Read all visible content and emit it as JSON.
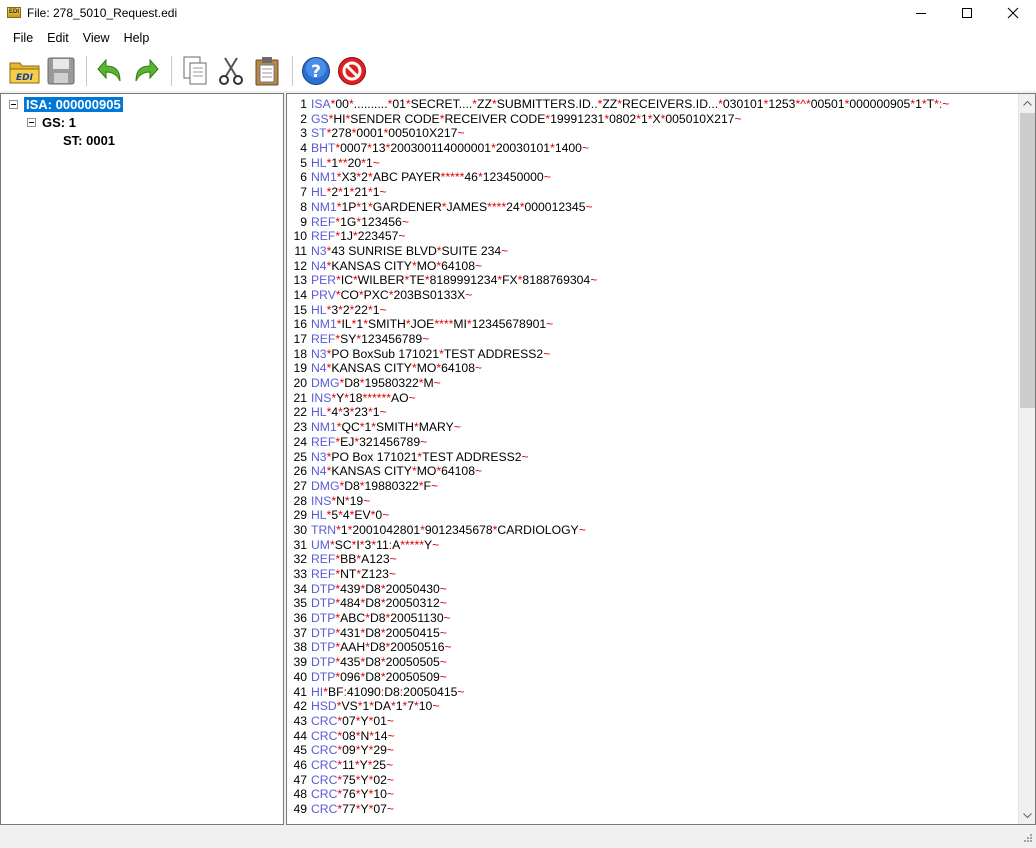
{
  "window": {
    "title": "File: 278_5010_Request.edi",
    "app_icon_text": "EDI"
  },
  "menu": [
    {
      "label": "File"
    },
    {
      "label": "Edit"
    },
    {
      "label": "View"
    },
    {
      "label": "Help"
    }
  ],
  "toolbar": {
    "icons": [
      "open-edi-icon",
      "save-icon",
      "undo-icon",
      "redo-icon",
      "copy-icon",
      "cut-icon",
      "paste-icon",
      "help-icon",
      "stop-icon"
    ],
    "open_text": "EDI"
  },
  "tree": {
    "isa": "ISA: 000000905",
    "gs": "GS: 1",
    "st": "ST: 0001"
  },
  "colors": {
    "segment": "#5b5bd6",
    "delimiter": "#e00000",
    "selection": "#0078d7"
  },
  "editor": {
    "lines": [
      {
        "n": "1",
        "seg": "ISA",
        "body": "*00*..........*01*SECRET....*ZZ*SUBMITTERS.ID..*ZZ*RECEIVERS.ID...*030101*1253*^*00501*000000905*1*T*:~"
      },
      {
        "n": "2",
        "seg": "GS",
        "body": "*HI*SENDER CODE*RECEIVER CODE*19991231*0802*1*X*005010X217~"
      },
      {
        "n": "3",
        "seg": "ST",
        "body": "*278*0001*005010X217~"
      },
      {
        "n": "4",
        "seg": "BHT",
        "body": "*0007*13*200300114000001*20030101*1400~"
      },
      {
        "n": "5",
        "seg": "HL",
        "body": "*1**20*1~"
      },
      {
        "n": "6",
        "seg": "NM1",
        "body": "*X3*2*ABC PAYER*****46*123450000~"
      },
      {
        "n": "7",
        "seg": "HL",
        "body": "*2*1*21*1~"
      },
      {
        "n": "8",
        "seg": "NM1",
        "body": "*1P*1*GARDENER*JAMES****24*000012345~"
      },
      {
        "n": "9",
        "seg": "REF",
        "body": "*1G*123456~"
      },
      {
        "n": "10",
        "seg": "REF",
        "body": "*1J*223457~"
      },
      {
        "n": "11",
        "seg": "N3",
        "body": "*43 SUNRISE BLVD*SUITE 234~"
      },
      {
        "n": "12",
        "seg": "N4",
        "body": "*KANSAS CITY*MO*64108~"
      },
      {
        "n": "13",
        "seg": "PER",
        "body": "*IC*WILBER*TE*8189991234*FX*8188769304~"
      },
      {
        "n": "14",
        "seg": "PRV",
        "body": "*CO*PXC*203BS0133X~"
      },
      {
        "n": "15",
        "seg": "HL",
        "body": "*3*2*22*1~"
      },
      {
        "n": "16",
        "seg": "NM1",
        "body": "*IL*1*SMITH*JOE****MI*12345678901~"
      },
      {
        "n": "17",
        "seg": "REF",
        "body": "*SY*123456789~"
      },
      {
        "n": "18",
        "seg": "N3",
        "body": "*PO BoxSub 171021*TEST ADDRESS2~"
      },
      {
        "n": "19",
        "seg": "N4",
        "body": "*KANSAS CITY*MO*64108~"
      },
      {
        "n": "20",
        "seg": "DMG",
        "body": "*D8*19580322*M~"
      },
      {
        "n": "21",
        "seg": "INS",
        "body": "*Y*18******AO~"
      },
      {
        "n": "22",
        "seg": "HL",
        "body": "*4*3*23*1~"
      },
      {
        "n": "23",
        "seg": "NM1",
        "body": "*QC*1*SMITH*MARY~"
      },
      {
        "n": "24",
        "seg": "REF",
        "body": "*EJ*321456789~"
      },
      {
        "n": "25",
        "seg": "N3",
        "body": "*PO Box 171021*TEST ADDRESS2~"
      },
      {
        "n": "26",
        "seg": "N4",
        "body": "*KANSAS CITY*MO*64108~"
      },
      {
        "n": "27",
        "seg": "DMG",
        "body": "*D8*19880322*F~"
      },
      {
        "n": "28",
        "seg": "INS",
        "body": "*N*19~"
      },
      {
        "n": "29",
        "seg": "HL",
        "body": "*5*4*EV*0~"
      },
      {
        "n": "30",
        "seg": "TRN",
        "body": "*1*2001042801*9012345678*CARDIOLOGY~"
      },
      {
        "n": "31",
        "seg": "UM",
        "body": "*SC*I*3*11:A*****Y~"
      },
      {
        "n": "32",
        "seg": "REF",
        "body": "*BB*A123~"
      },
      {
        "n": "33",
        "seg": "REF",
        "body": "*NT*Z123~"
      },
      {
        "n": "34",
        "seg": "DTP",
        "body": "*439*D8*20050430~"
      },
      {
        "n": "35",
        "seg": "DTP",
        "body": "*484*D8*20050312~"
      },
      {
        "n": "36",
        "seg": "DTP",
        "body": "*ABC*D8*20051130~"
      },
      {
        "n": "37",
        "seg": "DTP",
        "body": "*431*D8*20050415~"
      },
      {
        "n": "38",
        "seg": "DTP",
        "body": "*AAH*D8*20050516~"
      },
      {
        "n": "39",
        "seg": "DTP",
        "body": "*435*D8*20050505~"
      },
      {
        "n": "40",
        "seg": "DTP",
        "body": "*096*D8*20050509~"
      },
      {
        "n": "41",
        "seg": "HI",
        "body": "*BF:41090:D8:20050415~"
      },
      {
        "n": "42",
        "seg": "HSD",
        "body": "*VS*1*DA*1*7*10~"
      },
      {
        "n": "43",
        "seg": "CRC",
        "body": "*07*Y*01~"
      },
      {
        "n": "44",
        "seg": "CRC",
        "body": "*08*N*14~"
      },
      {
        "n": "45",
        "seg": "CRC",
        "body": "*09*Y*29~"
      },
      {
        "n": "46",
        "seg": "CRC",
        "body": "*11*Y*25~"
      },
      {
        "n": "47",
        "seg": "CRC",
        "body": "*75*Y*02~"
      },
      {
        "n": "48",
        "seg": "CRC",
        "body": "*76*Y*10~"
      },
      {
        "n": "49",
        "seg": "CRC",
        "body": "*77*Y*07~"
      }
    ]
  }
}
